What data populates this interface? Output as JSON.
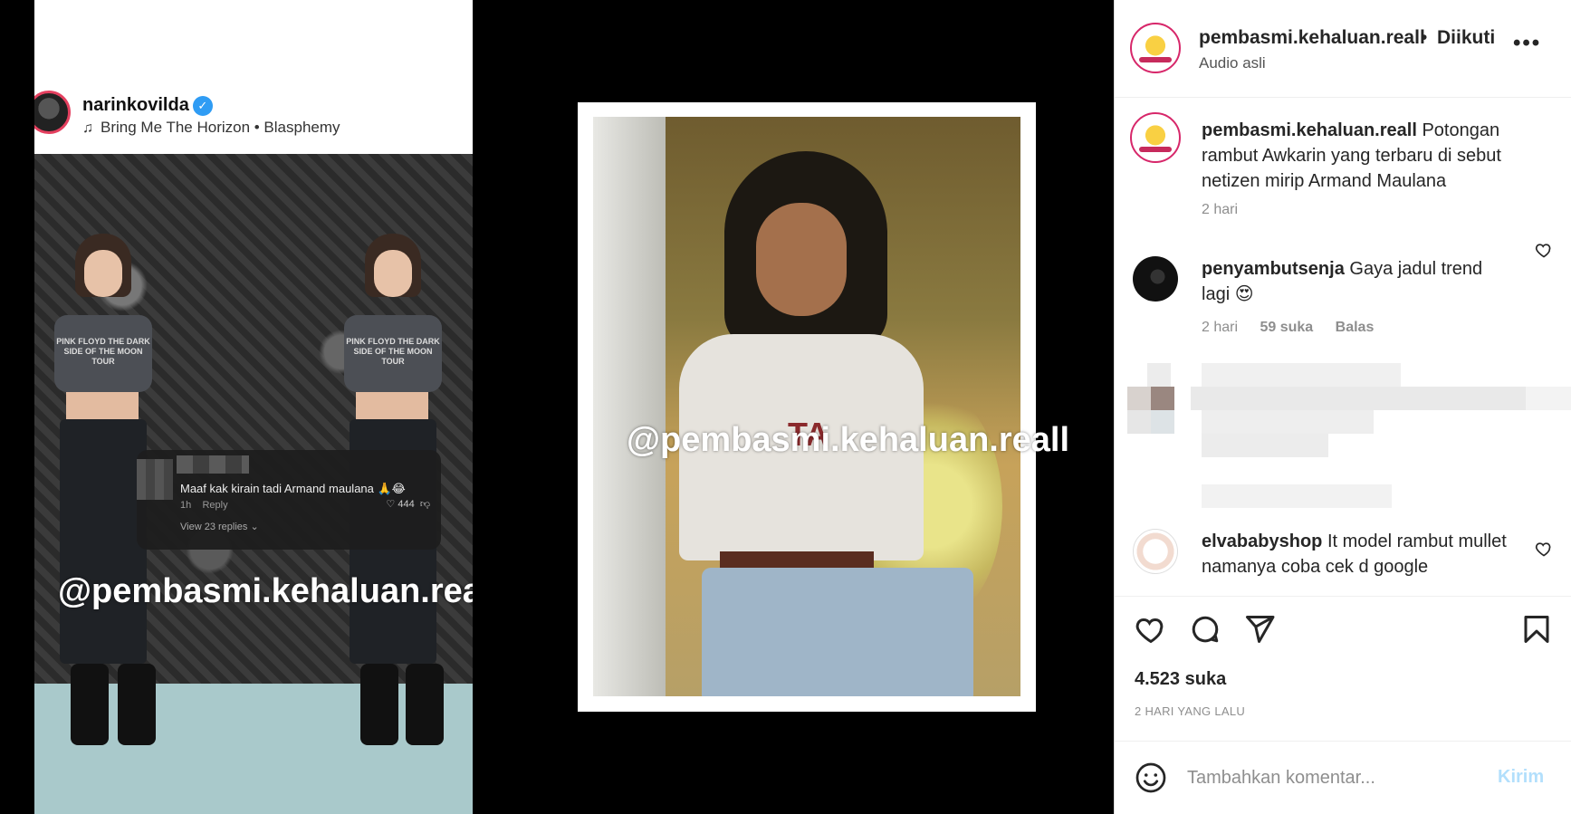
{
  "media": {
    "left_screenshot": {
      "username": "narinkovilda",
      "song": "Bring Me The Horizon • Blasphemy",
      "shirt_text": "PINK FLOYD THE DARK SIDE OF THE MOON TOUR",
      "comment_text": "Maaf kak kirain tadi Armand maulana 🙏😂",
      "comment_time": "1h",
      "comment_reply": "Reply",
      "comment_likes": "444",
      "view_replies": "View 23 replies ⌄",
      "watermark": "@pembasmi.kehaluan.reall"
    },
    "right_photo": {
      "jacket_text": "TA",
      "watermark": "@pembasmi.kehaluan.reall"
    }
  },
  "header": {
    "username": "pembasmi.kehaluan.reall",
    "separator": "•",
    "follow_status": "Diikuti",
    "audio": "Audio asli",
    "more": "•••"
  },
  "caption": {
    "username": "pembasmi.kehaluan.reall",
    "text": "Potongan rambut Awkarin yang terbaru di sebut netizen mirip Armand Maulana",
    "time": "2 hari"
  },
  "comments": [
    {
      "username": "penyambutsenja",
      "text": "Gaya jadul trend lagi 😍",
      "time": "2 hari",
      "likes": "59 suka",
      "reply": "Balas"
    },
    {
      "username": "elvababyshop",
      "text": "It model rambut mullet namanya coba cek d google"
    }
  ],
  "actions": {
    "likes": "4.523 suka",
    "date": "2 HARI YANG LALU"
  },
  "add_comment": {
    "placeholder": "Tambahkan komentar...",
    "post_label": "Kirim"
  },
  "colors": {
    "text": "#262626",
    "muted": "#8e8e8e",
    "post_disabled": "#b2dffc",
    "verified": "#2f9cf4"
  }
}
